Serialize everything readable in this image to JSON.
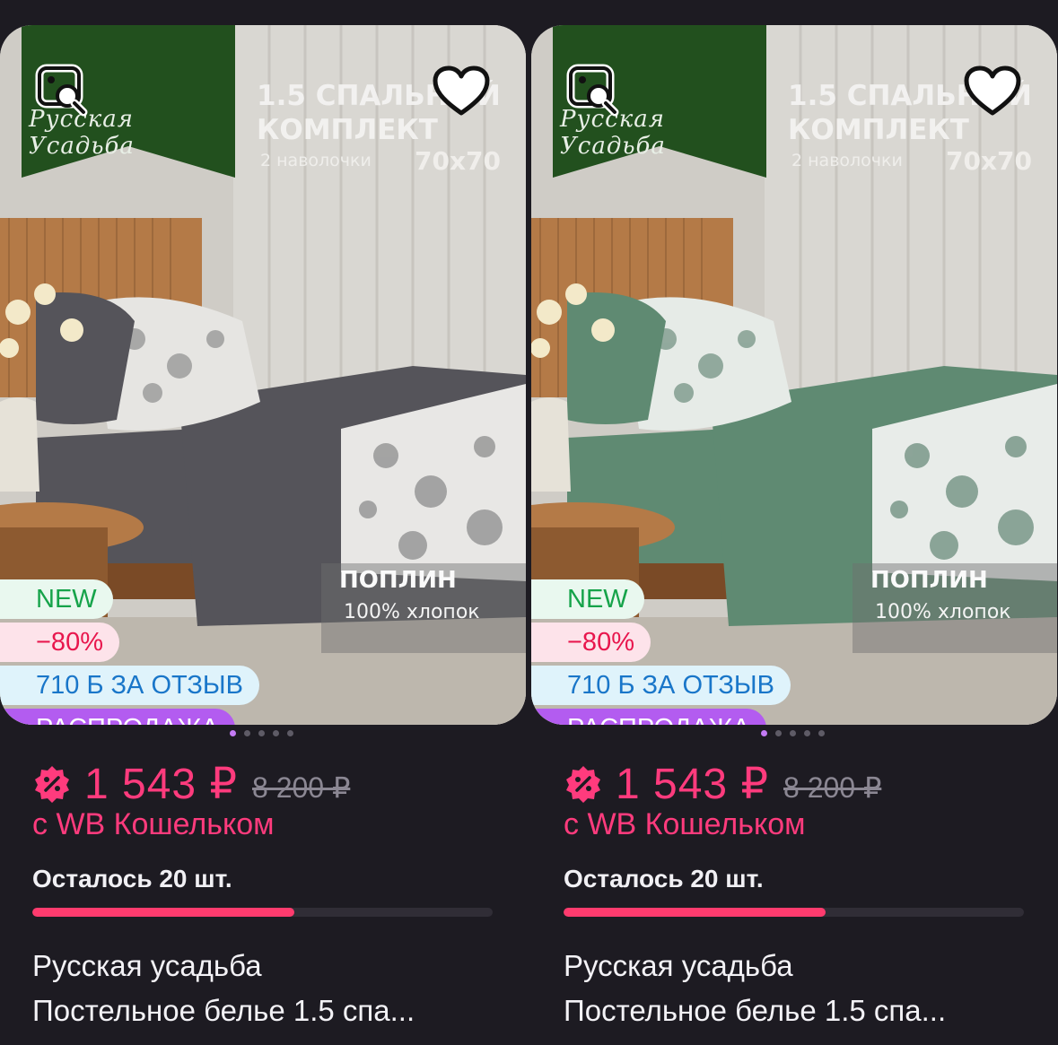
{
  "products": [
    {
      "brand_logo_text": "Русская Усадьба",
      "promo_title_lines": [
        "1.5 СПАЛЬНЫЙ",
        "КОМПЛЕКТ"
      ],
      "promo_pillowcases": "2 наволочки",
      "promo_size": "70х70",
      "material_title": "ПОПЛИН",
      "material_sub": "100% хлопок",
      "bedding_color": "#55545a",
      "badges": {
        "new": "NEW",
        "discount": "−80%",
        "review": "710 Б ЗА ОТЗЫВ",
        "sale": "РАСПРОДАЖА"
      },
      "slides_total": 5,
      "slide_active": 1,
      "price": "1 543 ₽",
      "old_price": "8 200 ₽",
      "price_note": "с WB Кошельком",
      "stock_text": "Осталось 20 шт.",
      "stock_fill_fraction": 0.57,
      "title_line1": "Русская усадьба",
      "title_line2": "Постельное белье 1.5 спа..."
    },
    {
      "brand_logo_text": "Русская Усадьба",
      "promo_title_lines": [
        "1.5 СПАЛЬНЫЙ",
        "КОМПЛЕКТ"
      ],
      "promo_pillowcases": "2 наволочки",
      "promo_size": "70х70",
      "material_title": "ПОПЛИН",
      "material_sub": "100% хлопок",
      "bedding_color": "#5f8a72",
      "badges": {
        "new": "NEW",
        "discount": "−80%",
        "review": "710 Б ЗА ОТЗЫВ",
        "sale": "РАСПРОДАЖА"
      },
      "slides_total": 5,
      "slide_active": 1,
      "price": "1 543 ₽",
      "old_price": "8 200 ₽",
      "price_note": "с WB Кошельком",
      "stock_text": "Осталось 20 шт.",
      "stock_fill_fraction": 0.57,
      "title_line1": "Русская усадьба",
      "title_line2": "Постельное белье 1.5 спа..."
    }
  ],
  "colors": {
    "accent_price": "#ff3b7d",
    "banner_green": "#22501e",
    "sale_purple": "#b35cf0"
  },
  "icons": {
    "image_search": "image-search-icon",
    "favorite": "heart-icon",
    "wallet": "wallet-discount-icon"
  }
}
